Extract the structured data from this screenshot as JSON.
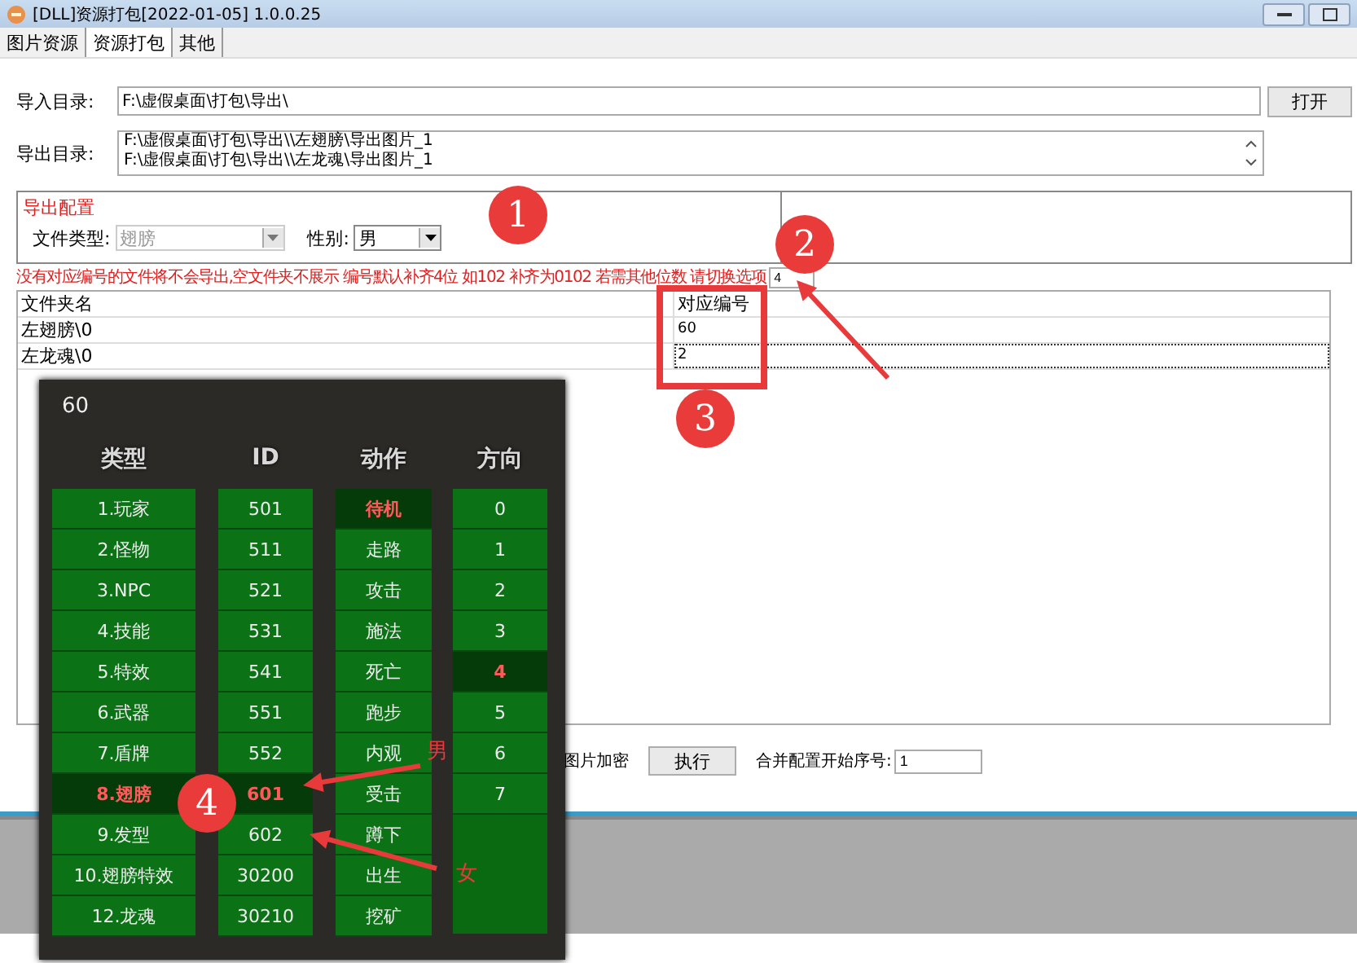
{
  "window": {
    "title": "[DLL]资源打包[2022-01-05] 1.0.0.25"
  },
  "tabs": [
    {
      "label": "图片资源",
      "selected": false
    },
    {
      "label": "资源打包",
      "selected": true
    },
    {
      "label": "其他",
      "selected": false
    }
  ],
  "import_dir": {
    "label": "导入目录:",
    "value": "F:\\虚假桌面\\打包\\导出\\",
    "button": "打开"
  },
  "export_dir": {
    "label": "导出目录:",
    "lines": [
      "F:\\虚假桌面\\打包\\导出\\\\左翅膀\\导出图片_1",
      "F:\\虚假桌面\\打包\\导出\\\\左龙魂\\导出图片_1"
    ]
  },
  "export_config": {
    "title": "导出配置",
    "file_type": {
      "label": "文件类型:",
      "value": "翅膀",
      "disabled": true
    },
    "gender": {
      "label": "性别:",
      "value": "男",
      "disabled": false
    }
  },
  "note": "没有对应编号的文件将不会导出,空文件夹不展示 编号默认补齐4位 如102 补齐为0102 若需其他位数 请切换选项",
  "pad_digits": "4",
  "table": {
    "columns": [
      "文件夹名",
      "对应编号"
    ],
    "rows": [
      {
        "cells": [
          "左翅膀\\0",
          "60"
        ],
        "selected": false
      },
      {
        "cells": [
          "左龙魂\\0",
          "2"
        ],
        "selected": true
      }
    ]
  },
  "footer": {
    "encrypt_label": "图片加密",
    "run_button": "执行",
    "start_label": "合并配置开始序号:",
    "start_value": "1"
  },
  "overlay": {
    "number": "60",
    "headers": [
      "类型",
      "ID",
      "动作",
      "方向"
    ],
    "columns": [
      [
        {
          "text": "1.玩家",
          "highlighted": false
        },
        {
          "text": "2.怪物",
          "highlighted": false
        },
        {
          "text": "3.NPC",
          "highlighted": false
        },
        {
          "text": "4.技能",
          "highlighted": false
        },
        {
          "text": "5.特效",
          "highlighted": false
        },
        {
          "text": "6.武器",
          "highlighted": false
        },
        {
          "text": "7.盾牌",
          "highlighted": false
        },
        {
          "text": "8.翅膀",
          "highlighted": true
        },
        {
          "text": "9.发型",
          "highlighted": false
        },
        {
          "text": "10.翅膀特效",
          "highlighted": false
        },
        {
          "text": "12.龙魂",
          "highlighted": false
        }
      ],
      [
        {
          "text": "501",
          "highlighted": false
        },
        {
          "text": "511",
          "highlighted": false
        },
        {
          "text": "521",
          "highlighted": false
        },
        {
          "text": "531",
          "highlighted": false
        },
        {
          "text": "541",
          "highlighted": false
        },
        {
          "text": "551",
          "highlighted": false
        },
        {
          "text": "552",
          "highlighted": false
        },
        {
          "text": "601",
          "highlighted": true
        },
        {
          "text": "602",
          "highlighted": false
        },
        {
          "text": "30200",
          "highlighted": false
        },
        {
          "text": "30210",
          "highlighted": false
        }
      ],
      [
        {
          "text": "待机",
          "highlighted": true
        },
        {
          "text": "走路",
          "highlighted": false
        },
        {
          "text": "攻击",
          "highlighted": false
        },
        {
          "text": "施法",
          "highlighted": false
        },
        {
          "text": "死亡",
          "highlighted": false
        },
        {
          "text": "跑步",
          "highlighted": false
        },
        {
          "text": "内观",
          "highlighted": false
        },
        {
          "text": "受击",
          "highlighted": false
        },
        {
          "text": "蹲下",
          "highlighted": false
        },
        {
          "text": "出生",
          "highlighted": false
        },
        {
          "text": "挖矿",
          "highlighted": false
        }
      ],
      [
        {
          "text": "0",
          "highlighted": false
        },
        {
          "text": "1",
          "highlighted": false
        },
        {
          "text": "2",
          "highlighted": false
        },
        {
          "text": "3",
          "highlighted": false
        },
        {
          "text": "4",
          "highlighted": true
        },
        {
          "text": "5",
          "highlighted": false
        },
        {
          "text": "6",
          "highlighted": false
        },
        {
          "text": "7",
          "highlighted": false
        }
      ]
    ]
  },
  "annotations": {
    "markers": [
      "1",
      "2",
      "3",
      "4"
    ],
    "labels": [
      "男",
      "女"
    ]
  }
}
